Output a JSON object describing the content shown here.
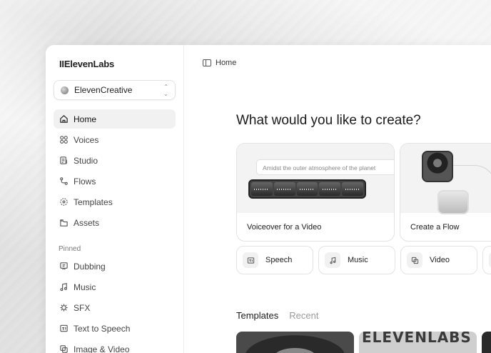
{
  "brand": {
    "logo_text": "IIElevenLabs"
  },
  "workspace": {
    "name": "ElevenCreative"
  },
  "nav": {
    "items": [
      {
        "label": "Home",
        "icon": "home-icon",
        "active": true
      },
      {
        "label": "Voices",
        "icon": "voices-icon"
      },
      {
        "label": "Studio",
        "icon": "studio-icon"
      },
      {
        "label": "Flows",
        "icon": "flows-icon"
      },
      {
        "label": "Templates",
        "icon": "templates-icon"
      },
      {
        "label": "Assets",
        "icon": "assets-icon"
      }
    ],
    "pinned_label": "Pinned",
    "pinned": [
      {
        "label": "Dubbing",
        "icon": "dubbing-icon"
      },
      {
        "label": "Music",
        "icon": "music-icon"
      },
      {
        "label": "SFX",
        "icon": "sfx-icon"
      },
      {
        "label": "Text to Speech",
        "icon": "text-to-speech-icon"
      },
      {
        "label": "Image & Video",
        "icon": "image-video-icon"
      }
    ]
  },
  "breadcrumb": {
    "label": "Home"
  },
  "main": {
    "headline": "What would you like to create?",
    "cards": [
      {
        "title": "Voiceover for a Video",
        "prompt": "Amidst the outer atmosphere of the planet"
      },
      {
        "title": "Create a Flow"
      }
    ],
    "quick_actions": [
      {
        "label": "Speech",
        "icon": "speech-icon"
      },
      {
        "label": "Music",
        "icon": "music-icon"
      },
      {
        "label": "Video",
        "icon": "video-icon"
      }
    ],
    "tabs": [
      {
        "label": "Templates",
        "active": true
      },
      {
        "label": "Recent",
        "active": false
      }
    ],
    "thumb_text": "ELEVENLABS"
  }
}
